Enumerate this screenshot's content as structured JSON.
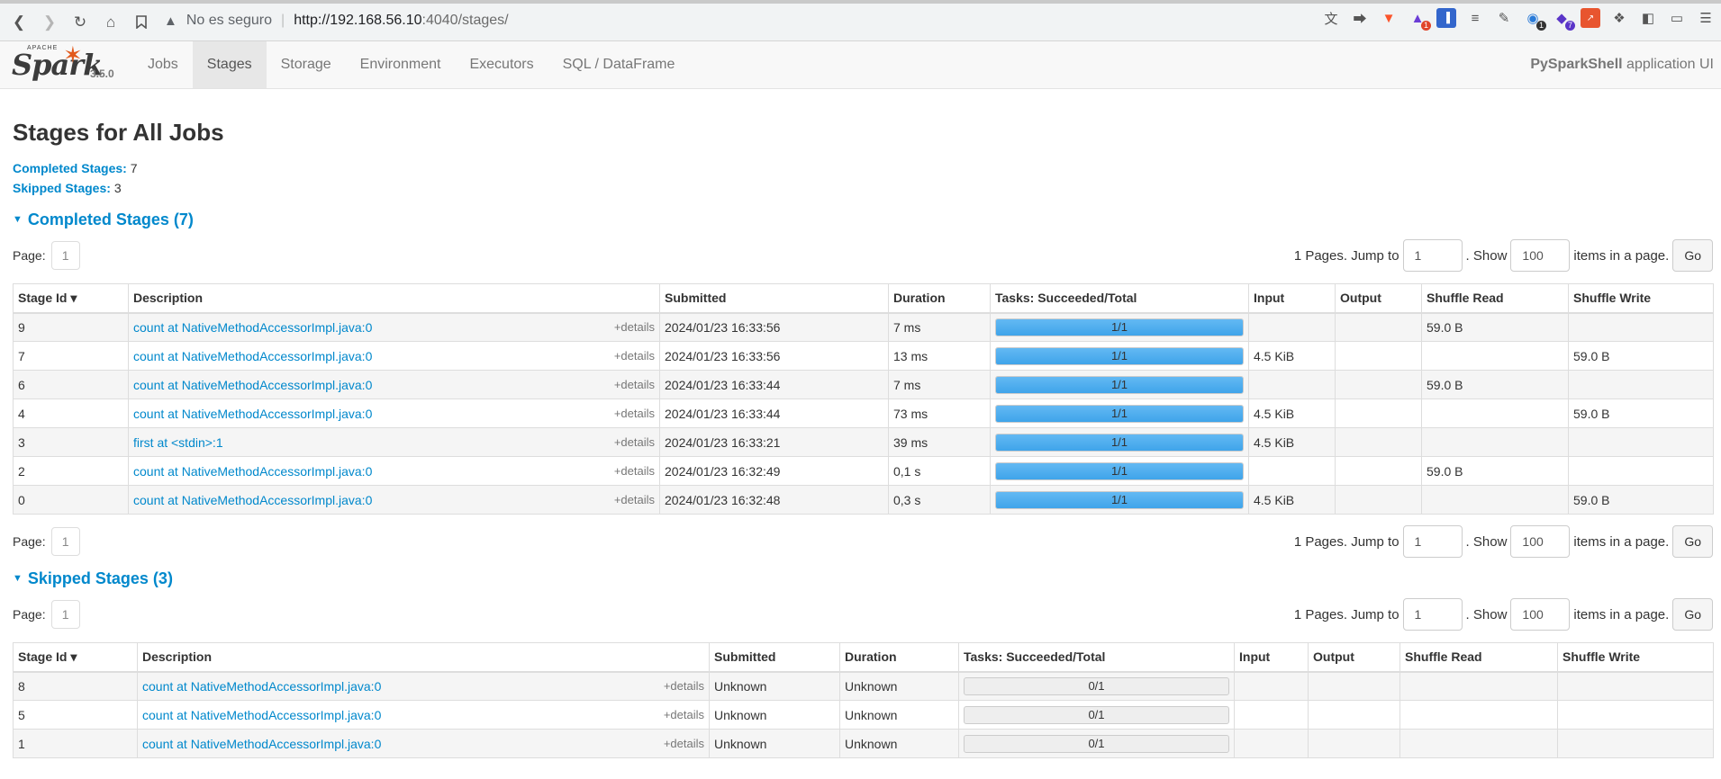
{
  "browser": {
    "insecure_label": "No es seguro",
    "url_host": "http://192.168.56.10",
    "url_path": ":4040/stages/",
    "extensions": [
      "translate-icon",
      "share-icon",
      "brave-icon",
      "brave-rewards-icon",
      "bookmark-ext-icon",
      "layers-icon",
      "pen-icon",
      "ext-badge-icon",
      "gem-icon",
      "devtools-icon",
      "puzzle-icon",
      "sidebar-icon",
      "wallet-icon",
      "menu-icon"
    ],
    "badges": {
      "rewards": "1",
      "ext1": "1",
      "gem": "7"
    }
  },
  "nav": {
    "logo_apache": "APACHE",
    "logo_word": "Spark",
    "version": "3.5.0",
    "tabs": [
      "Jobs",
      "Stages",
      "Storage",
      "Environment",
      "Executors",
      "SQL / DataFrame"
    ],
    "active_tab": "Stages",
    "app_name": "PySparkShell",
    "app_suffix": "application UI"
  },
  "page": {
    "title": "Stages for All Jobs",
    "completed_label": "Completed Stages:",
    "completed_count": "7",
    "skipped_label": "Skipped Stages:",
    "skipped_count": "3"
  },
  "pager": {
    "page_label": "Page:",
    "page_number": "1",
    "pages_text": "1 Pages. Jump to",
    "jump_value": "1",
    "show_text": ". Show",
    "show_value": "100",
    "items_text": "items in a page.",
    "go_label": "Go"
  },
  "completed": {
    "heading": "Completed Stages (7)",
    "columns": [
      "Stage Id ▾",
      "Description",
      "Submitted",
      "Duration",
      "Tasks: Succeeded/Total",
      "Input",
      "Output",
      "Shuffle Read",
      "Shuffle Write"
    ],
    "details_label": "+details",
    "rows": [
      {
        "id": "9",
        "desc": "count at NativeMethodAccessorImpl.java:0",
        "submitted": "2024/01/23 16:33:56",
        "duration": "7 ms",
        "tasks": "1/1",
        "progress": 1.0,
        "input": "",
        "output": "",
        "shuffle_read": "59.0 B",
        "shuffle_write": ""
      },
      {
        "id": "7",
        "desc": "count at NativeMethodAccessorImpl.java:0",
        "submitted": "2024/01/23 16:33:56",
        "duration": "13 ms",
        "tasks": "1/1",
        "progress": 1.0,
        "input": "4.5 KiB",
        "output": "",
        "shuffle_read": "",
        "shuffle_write": "59.0 B"
      },
      {
        "id": "6",
        "desc": "count at NativeMethodAccessorImpl.java:0",
        "submitted": "2024/01/23 16:33:44",
        "duration": "7 ms",
        "tasks": "1/1",
        "progress": 1.0,
        "input": "",
        "output": "",
        "shuffle_read": "59.0 B",
        "shuffle_write": ""
      },
      {
        "id": "4",
        "desc": "count at NativeMethodAccessorImpl.java:0",
        "submitted": "2024/01/23 16:33:44",
        "duration": "73 ms",
        "tasks": "1/1",
        "progress": 1.0,
        "input": "4.5 KiB",
        "output": "",
        "shuffle_read": "",
        "shuffle_write": "59.0 B"
      },
      {
        "id": "3",
        "desc": "first at <stdin>:1",
        "submitted": "2024/01/23 16:33:21",
        "duration": "39 ms",
        "tasks": "1/1",
        "progress": 1.0,
        "input": "4.5 KiB",
        "output": "",
        "shuffle_read": "",
        "shuffle_write": ""
      },
      {
        "id": "2",
        "desc": "count at NativeMethodAccessorImpl.java:0",
        "submitted": "2024/01/23 16:32:49",
        "duration": "0,1 s",
        "tasks": "1/1",
        "progress": 1.0,
        "input": "",
        "output": "",
        "shuffle_read": "59.0 B",
        "shuffle_write": ""
      },
      {
        "id": "0",
        "desc": "count at NativeMethodAccessorImpl.java:0",
        "submitted": "2024/01/23 16:32:48",
        "duration": "0,3 s",
        "tasks": "1/1",
        "progress": 1.0,
        "input": "4.5 KiB",
        "output": "",
        "shuffle_read": "",
        "shuffle_write": "59.0 B"
      }
    ]
  },
  "skipped": {
    "heading": "Skipped Stages (3)",
    "columns": [
      "Stage Id ▾",
      "Description",
      "Submitted",
      "Duration",
      "Tasks: Succeeded/Total",
      "Input",
      "Output",
      "Shuffle Read",
      "Shuffle Write"
    ],
    "details_label": "+details",
    "rows": [
      {
        "id": "8",
        "desc": "count at NativeMethodAccessorImpl.java:0",
        "submitted": "Unknown",
        "duration": "Unknown",
        "tasks": "0/1",
        "progress": 0.0,
        "input": "",
        "output": "",
        "shuffle_read": "",
        "shuffle_write": ""
      },
      {
        "id": "5",
        "desc": "count at NativeMethodAccessorImpl.java:0",
        "submitted": "Unknown",
        "duration": "Unknown",
        "tasks": "0/1",
        "progress": 0.0,
        "input": "",
        "output": "",
        "shuffle_read": "",
        "shuffle_write": ""
      },
      {
        "id": "1",
        "desc": "count at NativeMethodAccessorImpl.java:0",
        "submitted": "Unknown",
        "duration": "Unknown",
        "tasks": "0/1",
        "progress": 0.0,
        "input": "",
        "output": "",
        "shuffle_read": "",
        "shuffle_write": ""
      }
    ]
  }
}
